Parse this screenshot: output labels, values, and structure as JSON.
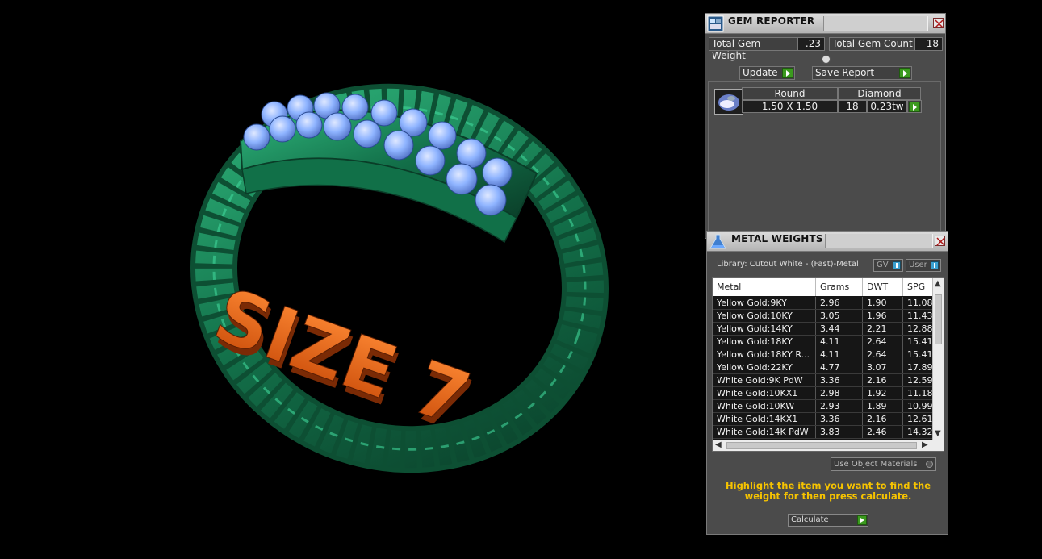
{
  "viewport": {
    "engraving_text": "SIZE 7"
  },
  "gem_reporter": {
    "title": "GEM REPORTER",
    "total_weight_label": "Total Gem Weight",
    "total_weight_value": ".23",
    "total_count_label": "Total Gem Count",
    "total_count_value": "18",
    "update_label": "Update",
    "save_report_label": "Save Report",
    "gems": [
      {
        "shape": "Round",
        "material": "Diamond",
        "size": "1.50 X 1.50",
        "count": "18",
        "weight": "0.23tw"
      }
    ]
  },
  "metal_weights": {
    "title": "METAL WEIGHTS",
    "library_label": "Library: Cutout White - (Fast)-Metal",
    "gv_label": "GV",
    "user_label": "User",
    "columns": [
      "Metal",
      "Grams",
      "DWT",
      "SPG"
    ],
    "rows": [
      {
        "metal": "Yellow Gold:9KY",
        "grams": "2.96",
        "dwt": "1.90",
        "spg": "11.08"
      },
      {
        "metal": "Yellow Gold:10KY",
        "grams": "3.05",
        "dwt": "1.96",
        "spg": "11.43"
      },
      {
        "metal": "Yellow Gold:14KY",
        "grams": "3.44",
        "dwt": "2.21",
        "spg": "12.88"
      },
      {
        "metal": "Yellow Gold:18KY",
        "grams": "4.11",
        "dwt": "2.64",
        "spg": "15.41"
      },
      {
        "metal": "Yellow Gold:18KY R...",
        "grams": "4.11",
        "dwt": "2.64",
        "spg": "15.41"
      },
      {
        "metal": "Yellow Gold:22KY",
        "grams": "4.77",
        "dwt": "3.07",
        "spg": "17.89"
      },
      {
        "metal": "White Gold:9K PdW",
        "grams": "3.36",
        "dwt": "2.16",
        "spg": "12.59"
      },
      {
        "metal": "White Gold:10KX1",
        "grams": "2.98",
        "dwt": "1.92",
        "spg": "11.18"
      },
      {
        "metal": "White Gold:10KW",
        "grams": "2.93",
        "dwt": "1.89",
        "spg": "10.99"
      },
      {
        "metal": "White Gold:14KX1",
        "grams": "3.36",
        "dwt": "2.16",
        "spg": "12.61"
      },
      {
        "metal": "White Gold:14K PdW",
        "grams": "3.83",
        "dwt": "2.46",
        "spg": "14.32"
      }
    ],
    "use_object_materials_label": "Use Object Materials",
    "hint_text": "Highlight the item you want to find the weight for then press calculate.",
    "calculate_label": "Calculate"
  },
  "colors": {
    "metal_green": "#1f8a5c",
    "gem_blue": "#8fb4ff",
    "text_orange": "#e8641a",
    "hint_yellow": "#f6c300",
    "go_green": "#3b9a1e"
  }
}
